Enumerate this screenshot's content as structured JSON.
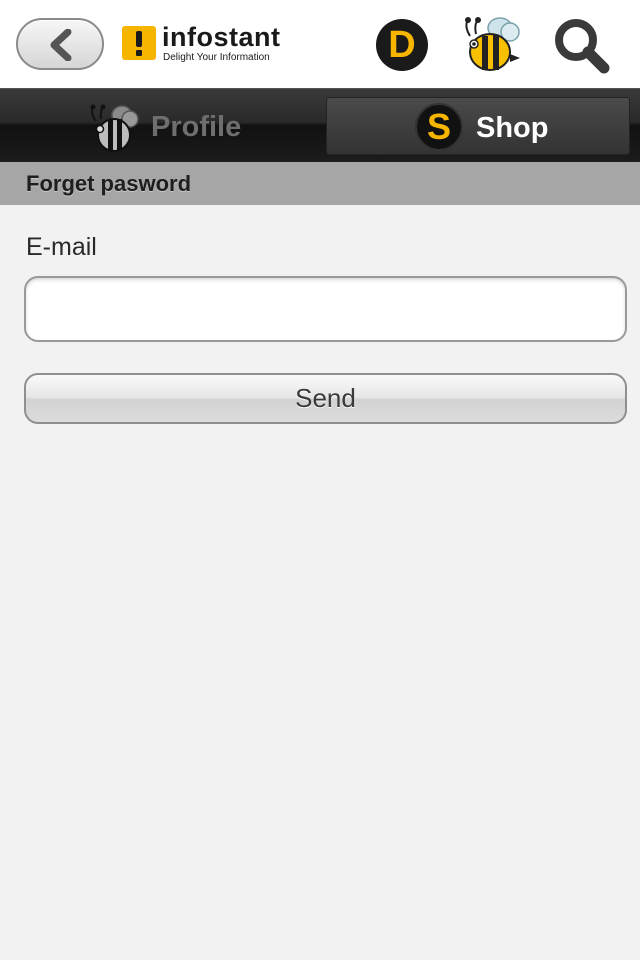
{
  "header": {
    "logo_name": "infostant",
    "logo_tagline": "Delight Your Information",
    "d_badge": "D"
  },
  "tabs": [
    {
      "label": "Profile",
      "icon": "bee-icon",
      "active": false
    },
    {
      "label": "Shop",
      "icon": "s-coin-icon",
      "badge": "S",
      "active": true
    }
  ],
  "section": {
    "title": "Forget pasword"
  },
  "form": {
    "email_label": "E-mail",
    "email_value": "",
    "email_placeholder": "",
    "send_label": "Send"
  },
  "colors": {
    "accent": "#f7b500",
    "tabbar": "#1c1c1c",
    "section_bg": "#a6a6a6",
    "page_bg": "#f2f2f2"
  }
}
